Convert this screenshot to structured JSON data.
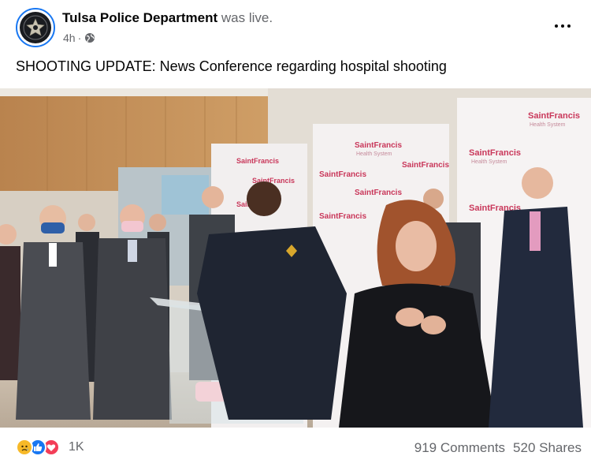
{
  "post": {
    "page_name": "Tulsa Police Department",
    "status": "was live.",
    "time": "4h",
    "separator": "·",
    "audience_icon": "globe-icon",
    "text": "SHOOTING UPDATE: News Conference regarding hospital shooting"
  },
  "video": {
    "backdrop_label": "SaintFrancis",
    "backdrop_sublabel": "Health System"
  },
  "footer": {
    "reaction_icons": [
      "sad-reaction-icon",
      "like-reaction-icon",
      "love-reaction-icon"
    ],
    "reaction_count": "1K",
    "comments": "919 Comments",
    "shares": "520 Shares"
  },
  "colors": {
    "accent": "#1877f2",
    "secondary_text": "#65676b",
    "love": "#f33e58",
    "sad": "#f7b928"
  }
}
